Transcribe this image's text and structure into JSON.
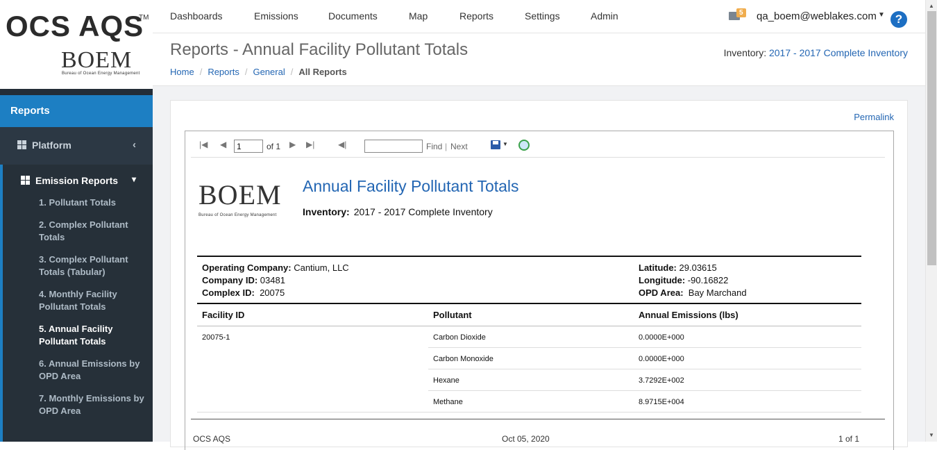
{
  "brand": {
    "app_name": "OCS AQS",
    "tm": "TM",
    "agency_logo": "BOEM",
    "agency_full": "Bureau of Ocean Energy Management"
  },
  "nav": {
    "items": [
      "Dashboards",
      "Emissions",
      "Documents",
      "Map",
      "Reports",
      "Settings",
      "Admin"
    ],
    "notification_count": "5",
    "user": "qa_boem@weblakes.com",
    "help": "?"
  },
  "sidebar": {
    "section_title": "Reports",
    "platform_label": "Platform",
    "emission_reports_label": "Emission Reports",
    "items": [
      "1. Pollutant Totals",
      "2. Complex Pollutant Totals",
      "3. Complex Pollutant Totals (Tabular)",
      "4. Monthly Facility Pollutant Totals",
      "5. Annual Facility Pollutant Totals",
      "6. Annual Emissions by OPD Area",
      "7. Monthly Emissions by OPD Area"
    ]
  },
  "header": {
    "title": "Reports - Annual Facility Pollutant Totals",
    "inventory_label": "Inventory:",
    "inventory_value": "2017 - 2017 Complete Inventory",
    "breadcrumb": [
      "Home",
      "Reports",
      "General",
      "All Reports"
    ]
  },
  "panel": {
    "permalink": "Permalink"
  },
  "toolbar": {
    "page_value": "1",
    "page_of": "of 1",
    "find_label": "Find",
    "sep": "|",
    "next_label": "Next",
    "find_value": ""
  },
  "report": {
    "logo": "BOEM",
    "logo_sub": "Bureau of Ocean Energy Management",
    "title": "Annual Facility Pollutant Totals",
    "inventory_label": "Inventory:",
    "inventory_value": "2017 - 2017 Complete Inventory",
    "operating_company_label": "Operating Company:",
    "operating_company": "Cantium, LLC",
    "company_id_label": "Company ID:",
    "company_id": "03481",
    "complex_id_label": "Complex ID:",
    "complex_id": "20075",
    "latitude_label": "Latitude:",
    "latitude": "29.03615",
    "longitude_label": "Longitude:",
    "longitude": "-90.16822",
    "opd_area_label": "OPD Area:",
    "opd_area": "Bay Marchand",
    "columns": [
      "Facility ID",
      "Pollutant",
      "Annual Emissions (lbs)"
    ],
    "facility_id": "20075-1",
    "rows": [
      {
        "pollutant": "Carbon Dioxide",
        "emissions": "0.0000E+000"
      },
      {
        "pollutant": "Carbon Monoxide",
        "emissions": "0.0000E+000"
      },
      {
        "pollutant": "Hexane",
        "emissions": "3.7292E+002"
      },
      {
        "pollutant": "Methane",
        "emissions": "8.9715E+004"
      }
    ],
    "footer_left": "OCS AQS",
    "footer_center": "Oct 05, 2020",
    "footer_right": "1 of 1"
  }
}
